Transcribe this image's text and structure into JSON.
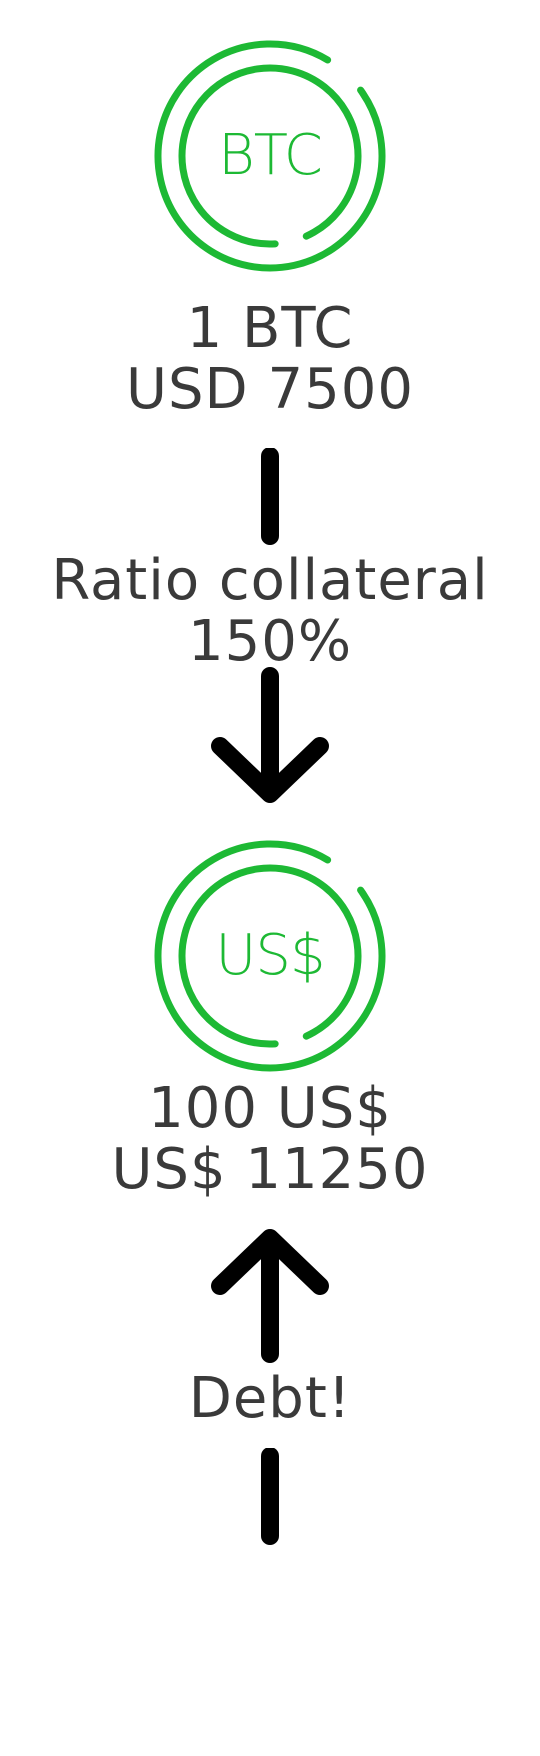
{
  "btc_coin": {
    "label": "BTC"
  },
  "btc_info": {
    "line1": "1 BTC",
    "line2": "USD 7500"
  },
  "ratio": {
    "line1": "Ratio collateral",
    "line2": "150%"
  },
  "usd_coin": {
    "label": "US$"
  },
  "usd_info": {
    "line1": "100 US$",
    "line2": "US$ 11250"
  },
  "debt": {
    "label": "Debt!"
  },
  "colors": {
    "accent": "#1db934",
    "text": "#3a3a3a",
    "connector": "#000000"
  }
}
